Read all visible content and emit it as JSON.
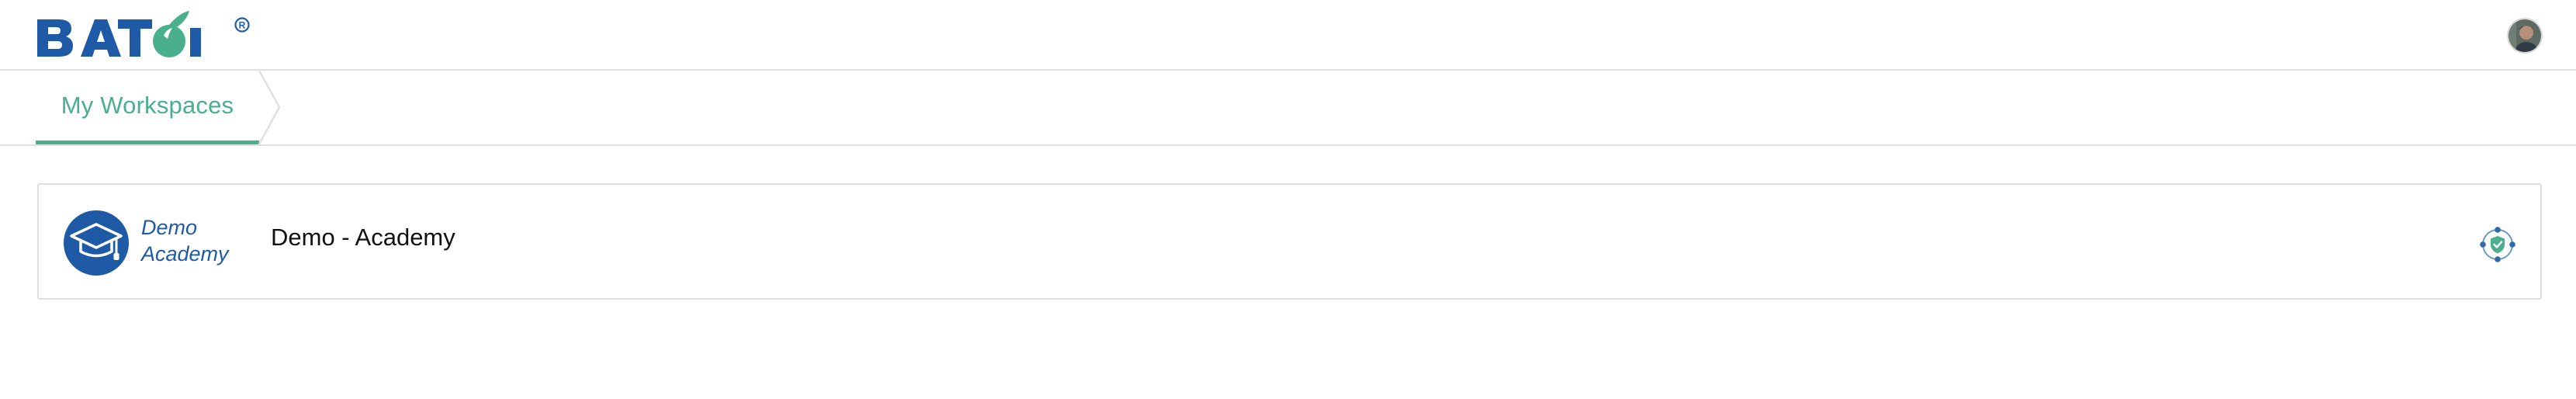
{
  "brand": {
    "logo_text": "BATOI",
    "registered_mark": "®",
    "colors": {
      "primary_blue": "#1f5aa6",
      "accent_green": "#4aaf8c"
    }
  },
  "header": {
    "avatar_icon": "user-avatar"
  },
  "breadcrumb": {
    "items": [
      {
        "label": "My Workspaces",
        "active": true
      }
    ],
    "separator_icon": "chevron-right-icon"
  },
  "workspaces": [
    {
      "logo_line1": "Demo",
      "logo_line2": "Academy",
      "logo_icon": "graduation-cap-icon",
      "name": "Demo - Academy",
      "action_icon": "admin-shield-icon"
    }
  ]
}
